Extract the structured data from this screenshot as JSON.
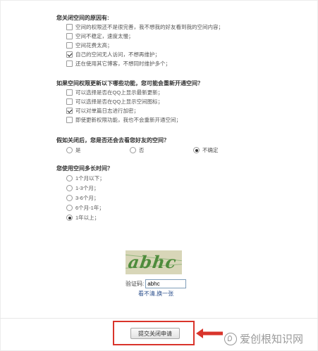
{
  "q1": {
    "title": "您关闭空间的原因有:",
    "options": [
      {
        "label": "空间的权限还不是很完善，我不想我的好友看到我的空间内容；",
        "checked": false
      },
      {
        "label": "空间不稳定，速度太慢；",
        "checked": false
      },
      {
        "label": "空间花费太高；",
        "checked": false
      },
      {
        "label": "自己的空间无人访问，不想再维护；",
        "checked": true
      },
      {
        "label": "还在使用其它博客，不想同时维护多个；",
        "checked": false
      }
    ]
  },
  "q2": {
    "title": "如果空间权限更新以下哪些功能，您可能会重新开通空间？",
    "options": [
      {
        "label": "可以选择是否在QQ上显示最新更新；",
        "checked": false
      },
      {
        "label": "可以选择是否在QQ上显示空间图标；",
        "checked": false
      },
      {
        "label": "可以对单篇日志进行加密；",
        "checked": true
      },
      {
        "label": "即使更新权限功能，我也不会重新开通空间；",
        "checked": false
      }
    ]
  },
  "q3": {
    "title": "假如关闭后，您是否还会去看您好友的空间？",
    "options": [
      {
        "label": "是",
        "checked": false
      },
      {
        "label": "否",
        "checked": false
      },
      {
        "label": "不确定",
        "checked": true
      }
    ]
  },
  "q4": {
    "title": "您使用空间多长时间？",
    "options": [
      {
        "label": "1个月以下；",
        "checked": false
      },
      {
        "label": "1-3个月；",
        "checked": false
      },
      {
        "label": "3-6个月；",
        "checked": false
      },
      {
        "label": "6个月-1年；",
        "checked": false
      },
      {
        "label": "1年以上；",
        "checked": true
      }
    ]
  },
  "captcha": {
    "image_text": "abhc",
    "label": "验证码:",
    "value": "abhc",
    "refresh_link": "看不清,换一张"
  },
  "submit": {
    "label": "提交关闭申请"
  },
  "watermark": {
    "text": "爱创根知识网"
  },
  "colors": {
    "highlight": "#d9342b",
    "link": "#2b4f8c",
    "captcha_bg": "#d8d6b8",
    "captcha_fg": "#4e8c3c"
  }
}
